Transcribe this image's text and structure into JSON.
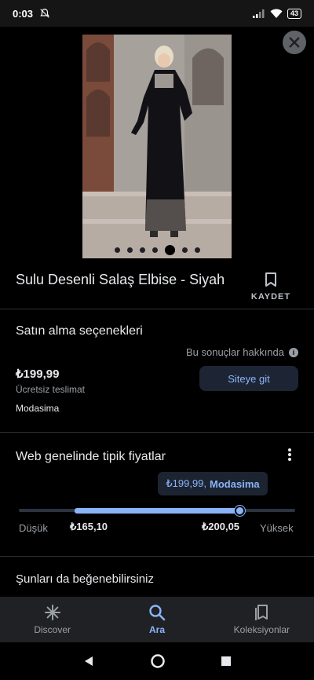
{
  "status_bar": {
    "time": "0:03",
    "battery": "43"
  },
  "product": {
    "title": "Sulu Desenli Salaş Elbise - Siyah",
    "save_label": "KAYDET",
    "image_count": 7,
    "active_image_index": 4
  },
  "purchase": {
    "section_title": "Satın alma seçenekleri",
    "about_label": "Bu sonuçlar hakkında",
    "price": "₺199,99",
    "delivery": "Ücretsiz teslimat",
    "merchant": "Modasima",
    "site_button_label": "Siteye git"
  },
  "typical_prices": {
    "section_title": "Web genelinde tipik fiyatlar",
    "tooltip_price": "₺199,99,",
    "tooltip_merchant": "Modasima",
    "low_label": "Düşük",
    "high_label": "Yüksek",
    "range_low": "₺165,10",
    "range_high": "₺200,05"
  },
  "similar": {
    "section_title": "Şunları da beğenebilirsiniz"
  },
  "bottom_nav": [
    {
      "label": "Discover",
      "icon": "asterisk-icon",
      "active": false
    },
    {
      "label": "Ara",
      "icon": "search-icon",
      "active": true
    },
    {
      "label": "Koleksiyonlar",
      "icon": "collections-icon",
      "active": false
    }
  ],
  "colors": {
    "accent": "#8ab4f8",
    "background": "#000000",
    "nav_background": "#202124"
  }
}
